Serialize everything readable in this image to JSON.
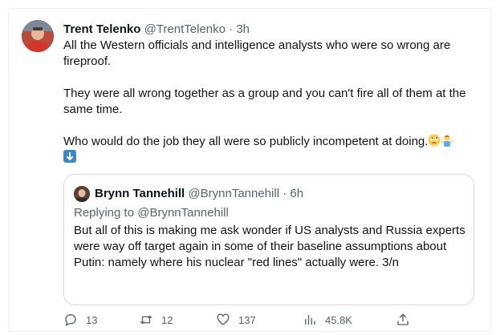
{
  "tweet": {
    "author_name": "Trent Telenko",
    "author_handle": "@TrentTelenko",
    "separator": "·",
    "time": "3h",
    "paragraphs": [
      "All the Western officials and intelligence  analysts who were so wrong are fireproof.",
      "They were all wrong together as a group and you can't fire all of them at the same time.",
      "Who would do the job they all were so publicly incompetent at doing."
    ],
    "emojis": [
      "rolling-eyes-emoji",
      "person-shrugging-emoji",
      "down-arrow-emoji"
    ]
  },
  "quote": {
    "author_name": "Brynn Tannehill",
    "author_handle": "@BrynnTannehill",
    "separator": "·",
    "time": "6h",
    "replying_to": "Replying to @BrynnTannehill",
    "text": "But all of this is making me ask wonder if US analysts and Russia experts were way off target again in some of their baseline assumptions about Putin: namely where his nuclear \"red lines\" actually were. 3/n"
  },
  "actions": {
    "replies": "13",
    "retweets": "12",
    "likes": "137",
    "views": "45.8K",
    "icons": [
      "reply-icon",
      "retweet-icon",
      "like-icon",
      "views-icon",
      "share-icon"
    ]
  },
  "colors": {
    "secondary_text": "#536471",
    "primary_text": "#0f1419",
    "border": "#cfd9de"
  }
}
